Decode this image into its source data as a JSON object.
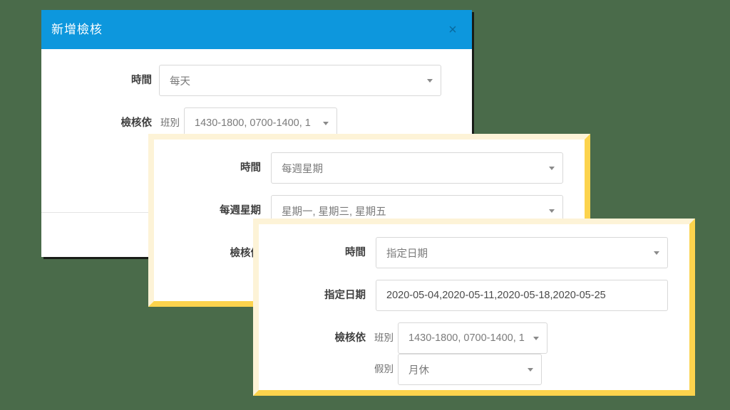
{
  "background_color": "#4a6b4a",
  "accent_blue": "#0d97dd",
  "highlight_yellow": "#fcd34d",
  "dialog": {
    "title": "新增檢核",
    "close_icon": "×",
    "rows": [
      {
        "label": "時間",
        "value": "每天",
        "control": "select"
      },
      {
        "label": "檢核依",
        "sub_label": "班別",
        "value": "1430-1800, 0700-1400, 1",
        "control": "select"
      }
    ]
  },
  "panel_weekly": {
    "rows": [
      {
        "label": "時間",
        "value": "每週星期",
        "control": "select"
      },
      {
        "label": "每週星期",
        "value": "星期一, 星期三, 星期五",
        "control": "select"
      },
      {
        "label": "檢核依",
        "value": "",
        "control": "none"
      }
    ]
  },
  "panel_dates": {
    "rows": [
      {
        "label": "時間",
        "value": "指定日期",
        "control": "select"
      },
      {
        "label": "指定日期",
        "value": "2020-05-04,2020-05-11,2020-05-18,2020-05-25",
        "control": "textbox"
      },
      {
        "label": "檢核依",
        "sub_label_1": "班別",
        "value_1": "1430-1800, 0700-1400, 1",
        "sub_label_2": "假別",
        "value_2": "月休"
      }
    ]
  }
}
